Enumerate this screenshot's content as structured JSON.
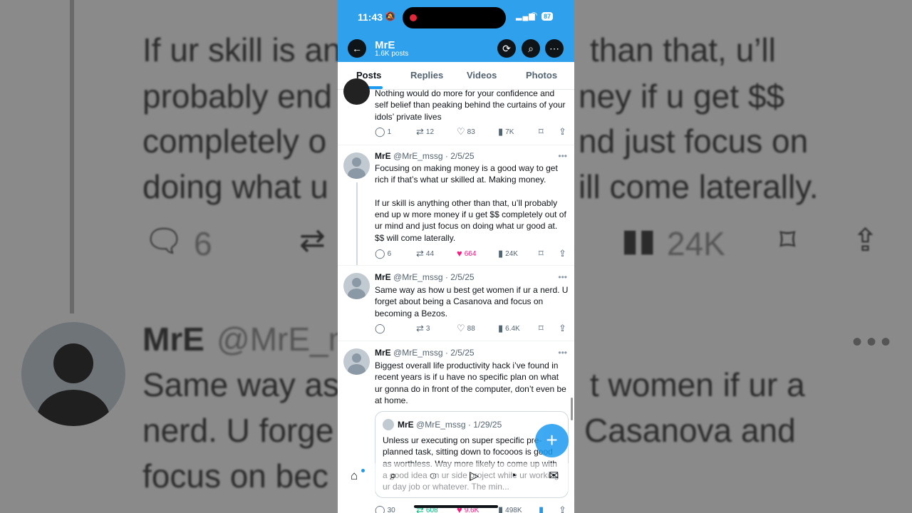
{
  "background": {
    "line1": "If ur skill is an",
    "line1b": "than that, u’ll",
    "line2": "probably end",
    "line2b": "ney if u get $$",
    "line3": "completely o",
    "line3b": "nd just focus on",
    "line4": "doing what u",
    "line4b": "ill come laterally.",
    "reply_count": "6",
    "view_count": "24K",
    "name": "MrE",
    "handle": "@MrE_m",
    "line5": "Same way as",
    "line5b": "t women if ur a",
    "line6": "nerd. U forge",
    "line6b": "Casanova and",
    "line7": "focus on bec"
  },
  "status_bar": {
    "time": "11:43",
    "battery": "87"
  },
  "header": {
    "name": "MrE",
    "post_count": "1.6K posts"
  },
  "tabs": [
    {
      "label": "Posts",
      "active": true
    },
    {
      "label": "Replies",
      "active": false
    },
    {
      "label": "Videos",
      "active": false
    },
    {
      "label": "Photos",
      "active": false
    }
  ],
  "tweets": [
    {
      "text": "Nothing would do more for your confidence and self belief than peaking behind the curtains of your idols’ private lives",
      "replies": "1",
      "reposts": "12",
      "likes": "83",
      "views": "7K"
    },
    {
      "name": "MrE",
      "handle": "@MrE_mssg",
      "date": "2/5/25",
      "text": "Focusing on making money is a good way to get rich if that’s what ur skilled at. Making money.\n\nIf ur skill is anything other than that, u’ll probably end up w more money if u get $$ completely out of ur mind and just focus on doing what ur good at. $$ will come laterally.",
      "replies": "6",
      "reposts": "44",
      "likes": "664",
      "views": "24K"
    },
    {
      "name": "MrE",
      "handle": "@MrE_mssg",
      "date": "2/5/25",
      "text": "Same way as how u best get women if ur a nerd. U forget about being a Casanova and focus on becoming a Bezos.",
      "replies": "",
      "reposts": "3",
      "likes": "88",
      "views": "6.4K"
    },
    {
      "name": "MrE",
      "handle": "@MrE_mssg",
      "date": "2/5/25",
      "text": "Biggest overall life productivity hack i’ve found in recent years is if u have no specific plan on what ur gonna do in front of the computer, don’t even be at home.",
      "quote": {
        "name": "MrE",
        "handle": "@MrE_mssg",
        "date": "1/29/25",
        "text": "Unless ur executing on super specific pre-planned task, sitting down to focooos is good as worthless. Way more likely to come up with a good idea on ur side project while ur working ur day job or whatever. The min..."
      },
      "replies": "30",
      "reposts": "608",
      "likes": "9.6K",
      "views": "498K"
    }
  ]
}
